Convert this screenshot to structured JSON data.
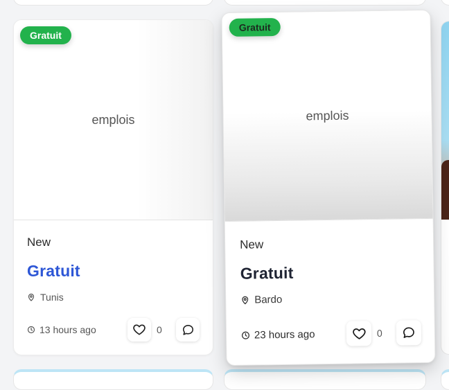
{
  "cards": [
    {
      "badge": "Gratuit",
      "media_label": "emplois",
      "status": "New",
      "title": "Gratuit",
      "location": "Tunis",
      "time": "13 hours ago",
      "likes": "0"
    },
    {
      "badge": "Gratuit",
      "media_label": "emplois",
      "status": "New",
      "title": "Gratuit",
      "location": "Bardo",
      "time": "23 hours ago",
      "likes": "0"
    }
  ],
  "colors": {
    "badge": "#22b24c",
    "title_link": "#2e57d6",
    "title_hover": "#1f2433"
  },
  "icons": {
    "location": "map-pin-icon",
    "time": "clock-icon",
    "like": "heart-icon",
    "comment": "comment-icon"
  }
}
